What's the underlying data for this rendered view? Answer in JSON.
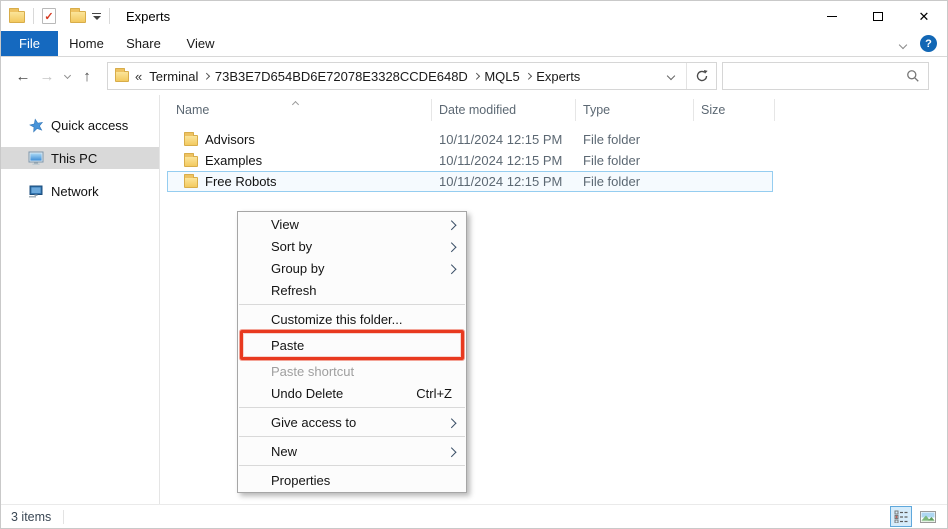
{
  "colors": {
    "accent_blue": "#1569bf",
    "annotation_red": "#e8391f",
    "selection_border": "#95cdf0",
    "sidebar_selected_bg": "#d9d9d9",
    "folder_yellow": "#f3c95f"
  },
  "titlebar": {
    "title": "Experts",
    "checkmark_glyph": "✓",
    "close_glyph": "✕"
  },
  "ribbon": {
    "tabs": [
      {
        "label": "File",
        "active": true
      },
      {
        "label": "Home",
        "active": false
      },
      {
        "label": "Share",
        "active": false
      },
      {
        "label": "View",
        "active": false
      }
    ],
    "help_glyph": "?"
  },
  "nav": {
    "back_glyph": "←",
    "forward_glyph": "→",
    "up_glyph": "↑",
    "overflow_glyph": "«",
    "breadcrumb": [
      "Terminal",
      "73B3E7D654BD6E72078E3328CCDE648D",
      "MQL5",
      "Experts"
    ],
    "search_value": "",
    "search_placeholder": ""
  },
  "sidebar": {
    "items": [
      {
        "label": "Quick access",
        "icon": "star-icon",
        "selected": false
      },
      {
        "label": "This PC",
        "icon": "monitor-icon",
        "selected": true
      },
      {
        "label": "Network",
        "icon": "network-icon",
        "selected": false
      }
    ]
  },
  "filelist": {
    "columns": [
      {
        "label": "Name"
      },
      {
        "label": "Date modified"
      },
      {
        "label": "Type"
      },
      {
        "label": "Size"
      }
    ],
    "rows": [
      {
        "name": "Advisors",
        "date_modified": "10/11/2024 12:15 PM",
        "type": "File folder",
        "size": "",
        "selected": false
      },
      {
        "name": "Examples",
        "date_modified": "10/11/2024 12:15 PM",
        "type": "File folder",
        "size": "",
        "selected": false
      },
      {
        "name": "Free Robots",
        "date_modified": "10/11/2024 12:15 PM",
        "type": "File folder",
        "size": "",
        "selected": true
      }
    ]
  },
  "context_menu": {
    "items": [
      {
        "label": "View",
        "submenu": true
      },
      {
        "label": "Sort by",
        "submenu": true
      },
      {
        "label": "Group by",
        "submenu": true
      },
      {
        "label": "Refresh",
        "submenu": false
      },
      {
        "label": "Customize this folder...",
        "submenu": false
      },
      {
        "label": "Paste",
        "submenu": false,
        "annotated": true
      },
      {
        "label": "Paste shortcut",
        "submenu": false,
        "disabled": true
      },
      {
        "label": "Undo Delete",
        "submenu": false,
        "shortcut": "Ctrl+Z"
      },
      {
        "label": "Give access to",
        "submenu": true
      },
      {
        "label": "New",
        "submenu": true
      },
      {
        "label": "Properties",
        "submenu": false
      }
    ]
  },
  "statusbar": {
    "items_count": "3 items"
  }
}
